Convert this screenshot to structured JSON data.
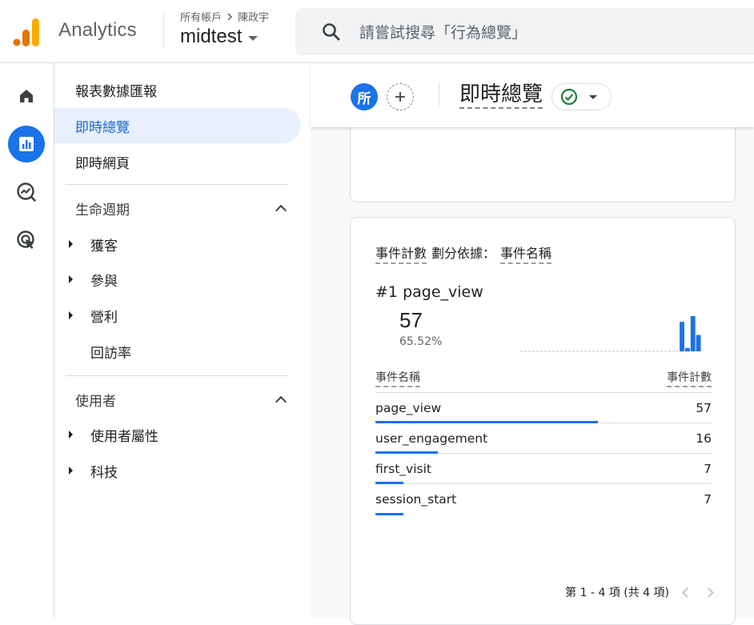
{
  "header": {
    "app_name": "Analytics",
    "breadcrumb_account": "所有帳戶",
    "breadcrumb_user": "陳政宇",
    "property": "midtest",
    "search_placeholder": "請嘗試搜尋「行為總覽」"
  },
  "rail": {
    "items": [
      {
        "icon": "home-icon",
        "active": false
      },
      {
        "icon": "reports-icon",
        "active": true
      },
      {
        "icon": "explore-icon",
        "active": false
      },
      {
        "icon": "advertising-icon",
        "active": false
      }
    ]
  },
  "sidebar": {
    "reports_snapshot": "報表數據匯報",
    "realtime_overview": "即時總覽",
    "realtime_pages": "即時網頁",
    "lifecycle_label": "生命週期",
    "lifecycle_items": [
      "獲客",
      "參與",
      "營利",
      "回訪率"
    ],
    "user_label": "使用者",
    "user_items": [
      "使用者屬性",
      "科技"
    ]
  },
  "toolbar": {
    "avatar_letter": "所",
    "page_title": "即時總覽"
  },
  "event_card": {
    "title_metric": "事件計數",
    "title_by": "劃分依據：",
    "title_dimension": "事件名稱",
    "top_rank": "#1",
    "top_name": "page_view",
    "top_value": "57",
    "top_percent": "65.52%",
    "col_event": "事件名稱",
    "col_count": "事件計數",
    "rows": [
      {
        "name": "page_view",
        "count": "57",
        "share": 0.6552
      },
      {
        "name": "user_engagement",
        "count": "16",
        "share": 0.1839
      },
      {
        "name": "first_visit",
        "count": "7",
        "share": 0.0805
      },
      {
        "name": "session_start",
        "count": "7",
        "share": 0.0805
      }
    ],
    "pagination": "第 1 - 4 項 (共 4 項)",
    "sparkline": [
      0,
      0,
      0,
      0,
      0,
      0,
      0,
      0,
      0,
      0,
      0,
      0,
      0,
      0,
      0,
      0,
      0,
      0,
      0,
      0,
      0,
      0,
      0,
      0,
      0,
      0,
      0,
      0,
      0,
      36,
      4,
      43,
      20
    ]
  },
  "colors": {
    "accent": "#1a73e8",
    "active_nav_bg": "#e8f0fe",
    "active_nav_text": "#1967d2",
    "success": "#188038",
    "logo_orange": "#f9ab00",
    "logo_dark_orange": "#e37400"
  }
}
